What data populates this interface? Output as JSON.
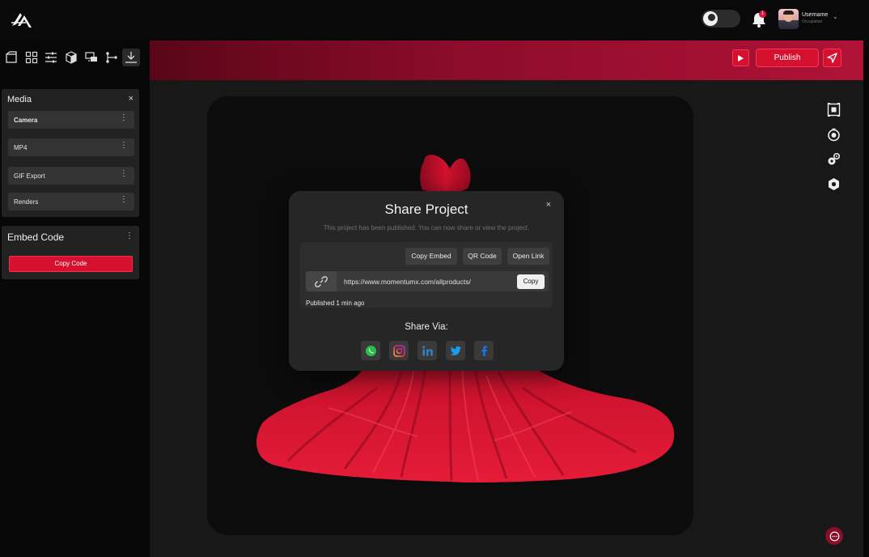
{
  "topbar": {
    "logo": "brand-logo",
    "theme_toggle": "dark-mode",
    "notification_count": "1",
    "user_name": "Username",
    "user_occupation": "Occupation",
    "caret": "⌄"
  },
  "left_toolbar": {
    "icons": [
      "scene-icon",
      "grid-icon",
      "sliders-icon",
      "cube-icon",
      "display-icon",
      "flow-icon",
      "download-icon"
    ],
    "active": "download-icon"
  },
  "media_panel": {
    "title": "Media",
    "close": "×",
    "items": [
      {
        "label": "Camera",
        "menu": "⋮"
      },
      {
        "label": "MP4",
        "menu": "⋮"
      },
      {
        "label": "GIF Export",
        "menu": "⋮"
      },
      {
        "label": "Renders",
        "menu": "⋮"
      }
    ]
  },
  "embed_panel": {
    "title": "Embed Code",
    "menu": "⋮",
    "copy_label": "Copy Code"
  },
  "header": {
    "publish_label": "Publish",
    "record_icon": "play-icon",
    "send_icon": "send-icon"
  },
  "right_toolbar": [
    "frame-icon",
    "timer-icon",
    "gears-icon",
    "hexagon-icon"
  ],
  "modal": {
    "title": "Share Project",
    "close": "×",
    "subtitle": "This project has been published. You can now share or view the project.",
    "actions": [
      "Copy Embed",
      "QR Code",
      "Open Link"
    ],
    "url": "https://www.momentumx.com/allproducts/",
    "copy_label": "Copy",
    "published_text": "Published 1 min ago",
    "share_via": "Share Via:",
    "socials": [
      "whatsapp-icon",
      "instagram-icon",
      "linkedin-icon",
      "twitter-icon",
      "facebook-icon"
    ]
  },
  "colors": {
    "accent": "#d6112f",
    "banner_dark": "#5a0618",
    "banner_light": "#b01236",
    "panel_bg": "#222222",
    "modal_bg": "#262626",
    "dress_red": "#c8102e"
  }
}
